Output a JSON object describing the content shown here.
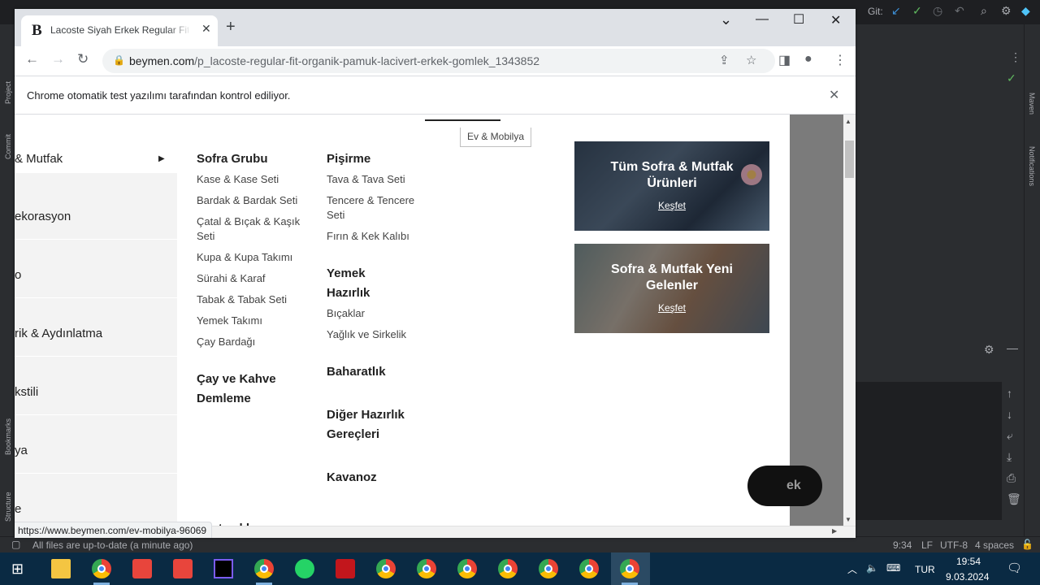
{
  "ide": {
    "left_labels": [
      "Project",
      "Commit",
      "Bookmarks",
      "Structure"
    ],
    "right_labels": [
      "Maven",
      "Notifications"
    ],
    "git_label": "Git:",
    "status_left": "All files are up-to-date (a minute ago)",
    "status_right": {
      "position": "9:34",
      "line_sep": "LF",
      "encoding": "UTF-8",
      "indent": "4 spaces"
    }
  },
  "browser": {
    "tab": {
      "favicon": "B",
      "title": "Lacoste Siyah Erkek Regular Fit Gömlek",
      "close": "✕"
    },
    "new_tab": "+",
    "window_controls": {
      "dropdown": "⌄",
      "minimize": "—",
      "maximize": "☐",
      "close": "✕"
    },
    "url_host": "beymen.com",
    "url_path": "/p_lacoste-regular-fit-organik-pamuk-lacivert-erkek-gomlek_1343852",
    "infobar_text": "Chrome otomatik test yazılımı tarafından kontrol ediliyor.",
    "status_url": "https://www.beymen.com/ev-mobilya-96069"
  },
  "page": {
    "hover_tooltip": "Ev & Mobilya",
    "categories": [
      {
        "label": "& Mutfak",
        "active": true
      },
      {
        "label": "ekorasyon",
        "active": false
      },
      {
        "label": "o",
        "active": false
      },
      {
        "label": "rik & Aydınlatma",
        "active": false
      },
      {
        "label": "kstili",
        "active": false
      },
      {
        "label": "ya",
        "active": false
      },
      {
        "label": "e",
        "active": false
      }
    ],
    "col1": {
      "heading": "Sofra Grubu",
      "links": [
        "Kase & Kase Seti",
        "Bardak & Bardak Seti",
        "Çatal & Bıçak & Kaşık Seti",
        "Kupa & Kupa Takımı",
        "Sürahi & Karaf",
        "Tabak & Tabak Seti",
        "Yemek Takımı",
        "Çay Bardağı"
      ],
      "heading2": "Çay ve Kahve Demleme",
      "heading3": "Pastacılık"
    },
    "col2": {
      "heading": "Pişirme",
      "links": [
        "Tava & Tava Seti",
        "Tencere & Tencere Seti",
        "Fırın & Kek Kalıbı"
      ],
      "heading2": "Yemek Hazırlık",
      "links2": [
        "Bıçaklar",
        "Yağlık ve Sirkelik"
      ],
      "heading3": "Baharatlık",
      "heading4": "Diğer Hazırlık Gereçleri",
      "heading5": "Kavanoz"
    },
    "promos": [
      {
        "title": "Tüm Sofra & Mutfak Ürünleri",
        "link": "Keşfet"
      },
      {
        "title": "Sofra & Mutfak Yeni Gelenler",
        "link": "Keşfet"
      }
    ],
    "floating_button_text": "ek"
  },
  "taskbar": {
    "language": "TUR",
    "time": "19:54",
    "date": "9.03.2024"
  }
}
